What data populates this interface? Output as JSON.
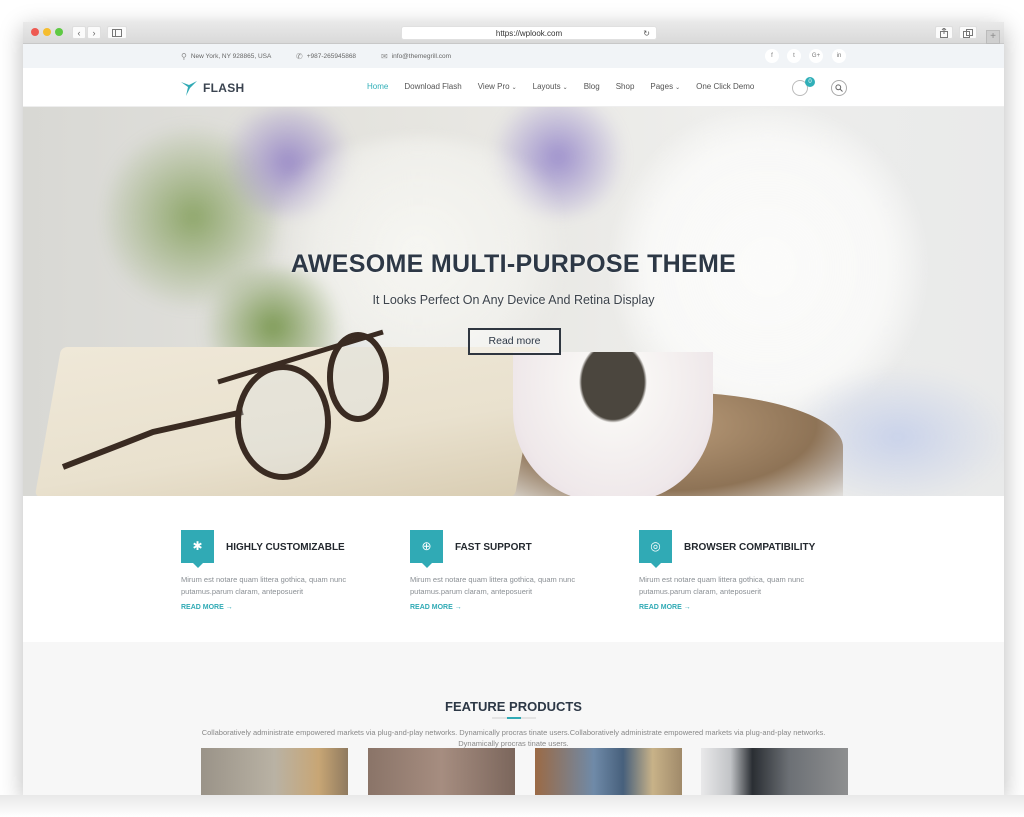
{
  "browser": {
    "url": "https://wplook.com",
    "back_icon": "‹",
    "forward_icon": "›",
    "reload_icon": "↻",
    "plus_icon": "+"
  },
  "infobar": {
    "address": "New York, NY 928865, USA",
    "phone": "+987-265945868",
    "email": "info@themegrill.com",
    "social": [
      "f",
      "t",
      "G+",
      "in"
    ]
  },
  "header": {
    "logo_text": "FLASH",
    "nav": [
      {
        "label": "Home",
        "active": true,
        "dropdown": false
      },
      {
        "label": "Download Flash",
        "active": false,
        "dropdown": false
      },
      {
        "label": "View Pro",
        "active": false,
        "dropdown": true
      },
      {
        "label": "Layouts",
        "active": false,
        "dropdown": true
      },
      {
        "label": "Blog",
        "active": false,
        "dropdown": false
      },
      {
        "label": "Shop",
        "active": false,
        "dropdown": false
      },
      {
        "label": "Pages",
        "active": false,
        "dropdown": true
      },
      {
        "label": "One Click Demo",
        "active": false,
        "dropdown": false
      }
    ],
    "cart_count": "0",
    "caret": "⌄"
  },
  "hero": {
    "title": "AWESOME MULTI-PURPOSE THEME",
    "subtitle": "It Looks Perfect On Any Device And Retina Display",
    "button": "Read more"
  },
  "features": [
    {
      "icon": "gear-icon",
      "glyph": "✱",
      "title": "HIGHLY CUSTOMIZABLE",
      "desc": "Mirum est notare quam littera gothica, quam nunc putamus.parum claram, anteposuerit",
      "link": "READ MORE →"
    },
    {
      "icon": "life-ring-icon",
      "glyph": "⊕",
      "title": "FAST SUPPORT",
      "desc": "Mirum est notare quam littera gothica, quam nunc putamus.parum claram, anteposuerit",
      "link": "READ MORE →"
    },
    {
      "icon": "chrome-icon",
      "glyph": "◎",
      "title": "BROWSER COMPATIBILITY",
      "desc": "Mirum est notare quam littera gothica, quam nunc putamus.parum claram, anteposuerit",
      "link": "READ MORE →"
    }
  ],
  "products": {
    "title": "FEATURE PRODUCTS",
    "description": "Collaboratively administrate empowered markets via plug-and-play networks. Dynamically procras tinate users.Collaboratively administrate empowered markets via plug-and-play networks. Dynamically procras tinate users."
  },
  "colors": {
    "accent": "#30aab5",
    "dark_text": "#2d3846"
  }
}
